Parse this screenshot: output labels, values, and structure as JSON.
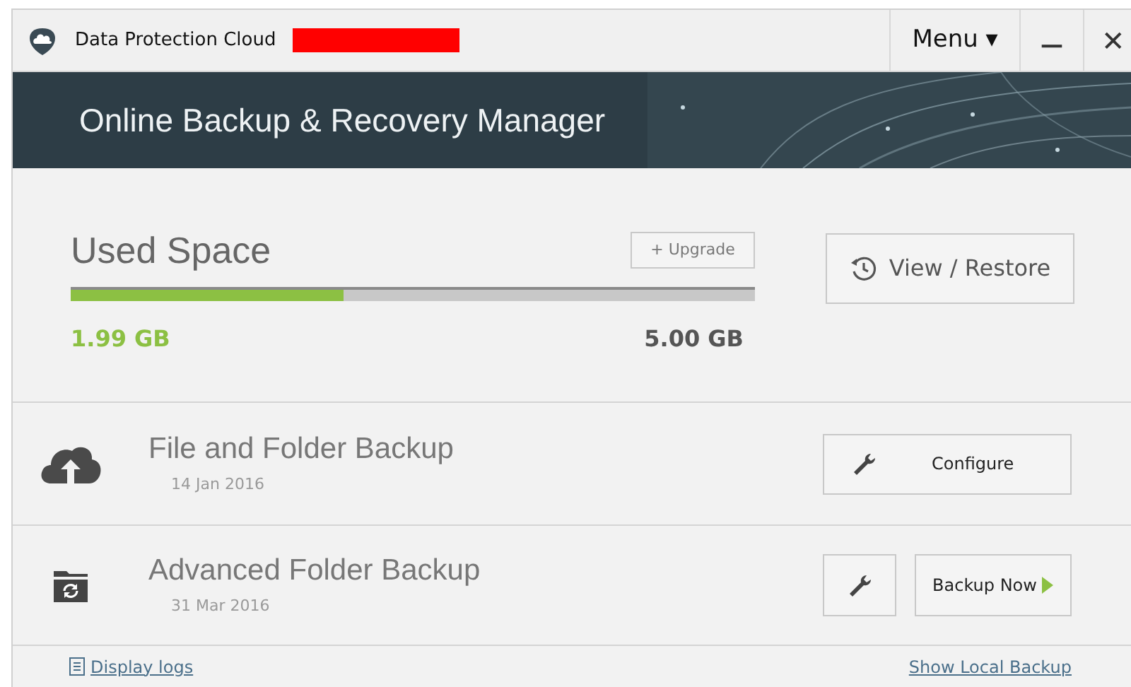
{
  "window": {
    "title": "Data Protection Cloud",
    "menu": "Menu ▾",
    "minimize": "—",
    "close": "✕"
  },
  "banner": {
    "title": "Online Backup & Recovery Manager",
    "kind": "picture"
  },
  "used_space": {
    "title": "Used Space",
    "upgrade": "+ Upgrade",
    "level": 0.398,
    "used": "1.99 GB",
    "total": "5.00 GB",
    "view_restore": "View / Restore"
  },
  "backups": [
    {
      "kind": "upload",
      "title": "File and Folder Backup",
      "date": "14 Jan 2016",
      "configure": "Configure"
    },
    {
      "kind": "advanced",
      "title": "Advanced Folder Backup",
      "date": "31 Mar 2016",
      "action": "Backup Now"
    }
  ],
  "footer": {
    "display_logs": "Display logs",
    "show_local_backup": "Show Local Backup"
  }
}
